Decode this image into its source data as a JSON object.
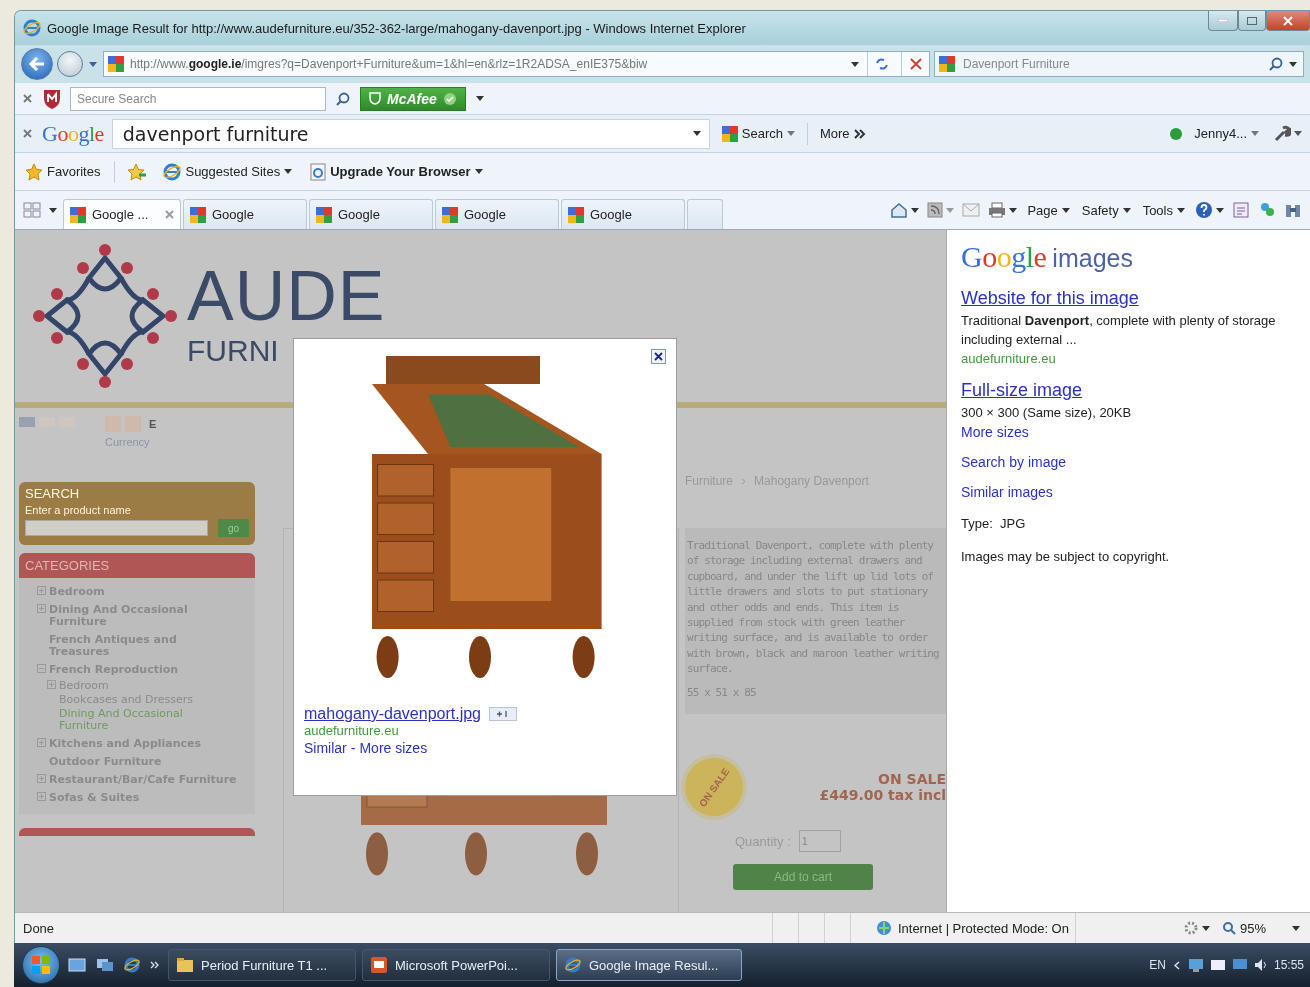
{
  "window": {
    "title": "Google Image Result for http://www.audefurniture.eu/352-362-large/mahogany-davenport.jpg - Windows Internet Explorer"
  },
  "address_bar": {
    "url": "http://www.**google.ie**/imgres?q=Davenport+Furniture&um=1&hl=en&rlz=1R2ADSA_enIE375&biw",
    "search_placeholder": "Davenport Furniture"
  },
  "mcafee_bar": {
    "search_placeholder": "Secure Search",
    "brand": "McAfee"
  },
  "google_toolbar": {
    "logo": "Google",
    "query": "davenport furniture",
    "search_label": "Search",
    "more_label": "More",
    "user": "Jenny4..."
  },
  "favorites_bar": {
    "items": [
      {
        "label": "Favorites",
        "kind": "favorites",
        "bold": false
      },
      {
        "label": "Suggested Sites",
        "kind": "feed",
        "bold": false
      },
      {
        "label": "Upgrade Your Browser",
        "kind": "page",
        "bold": true
      }
    ]
  },
  "tabs": [
    {
      "label": "Google ...",
      "selected": true,
      "closable": true
    },
    {
      "label": "Google",
      "selected": false,
      "closable": false
    },
    {
      "label": "Google",
      "selected": false,
      "closable": false
    },
    {
      "label": "Google",
      "selected": false,
      "closable": false
    },
    {
      "label": "Google",
      "selected": false,
      "closable": false
    }
  ],
  "command_bar": {
    "menus": [
      "Page",
      "Safety",
      "Tools"
    ]
  },
  "site": {
    "logo": {
      "name": "AUDE",
      "subtitle": "FURNI"
    },
    "currency": {
      "current_symbol": "E",
      "label": "Currency"
    },
    "search": {
      "title": "SEARCH",
      "hint": "Enter a product name",
      "button": "go"
    },
    "categories": {
      "title": "CATEGORIES",
      "items": [
        {
          "label": "Bedroom",
          "expandable": true,
          "expanded": false,
          "selected": false
        },
        {
          "label": "Dining And Occasional Furniture",
          "expandable": true,
          "expanded": false,
          "selected": false
        },
        {
          "label": "French Antiques and Treasures",
          "expandable": false,
          "selected": false
        },
        {
          "label": "French Reproduction",
          "expandable": true,
          "expanded": true,
          "selected": false,
          "children": [
            {
              "label": "Bedroom",
              "expandable": true,
              "expanded": false,
              "selected": false
            },
            {
              "label": "Bookcases and Dressers",
              "expandable": false,
              "selected": false
            },
            {
              "label": "Dining And Occasional Furniture",
              "expandable": false,
              "selected": true
            }
          ]
        },
        {
          "label": "Kitchens and Appliances",
          "expandable": true,
          "expanded": false,
          "selected": false
        },
        {
          "label": "Outdoor Furniture",
          "expandable": false,
          "selected": false
        },
        {
          "label": "Restaurant/Bar/Cafe Furniture",
          "expandable": true,
          "expanded": false,
          "selected": false
        },
        {
          "label": "Sofas & Suites",
          "expandable": true,
          "expanded": false,
          "selected": false
        }
      ]
    },
    "breadcrumb": [
      "Furniture",
      "Mahogany Davenport"
    ],
    "description": "Traditional Davenport, complete with plenty of storage including external drawers and cupboard, and under the lift up lid lots of little drawers and slots to put stationary and other odds and ends. This item is supplied from stock with green leather writing surface, and is available to order with brown, black and maroon leather writing surface.",
    "dimensions": "55 x 51 x 85",
    "sale": {
      "badge": "ON SALE",
      "label": "ON SALE",
      "price": "£449.00 tax incl"
    },
    "quantity": {
      "label": "Quantity :",
      "value": "1"
    },
    "add_to_cart": "Add to cart"
  },
  "image_popup": {
    "filename": "mahogany-davenport.jpg",
    "domain": "audefurniture.eu",
    "links": [
      "Similar",
      "More sizes"
    ],
    "separator": "-"
  },
  "details_panel": {
    "logo": "Google",
    "logo_suffix": "images",
    "sections": [
      {
        "kind": "result",
        "link": "Website for this image",
        "snippet": "Traditional **Davenport**, complete with plenty of storage including external ...",
        "domain": "audefurniture.eu"
      },
      {
        "kind": "size",
        "link": "Full-size image",
        "info": "300 × 300 (Same size), 20KB",
        "sublink": "More sizes"
      },
      {
        "kind": "link",
        "link": "Search by image"
      },
      {
        "kind": "link",
        "link": "Similar images"
      },
      {
        "kind": "type",
        "label": "Type:",
        "value": "JPG"
      },
      {
        "kind": "note",
        "text": "Images may be subject to copyright."
      }
    ]
  },
  "status_bar": {
    "status": "Done",
    "zone": "Internet | Protected Mode: On",
    "zoom": "95%"
  },
  "taskbar": {
    "tasks": [
      {
        "label": "Period Furniture T1 ...",
        "kind": "folder",
        "selected": false
      },
      {
        "label": "Microsoft PowerPoi...",
        "kind": "slides",
        "selected": false
      },
      {
        "label": "Google Image Resul...",
        "kind": "browser",
        "selected": true
      }
    ],
    "language": "EN",
    "clock": "15:55"
  }
}
